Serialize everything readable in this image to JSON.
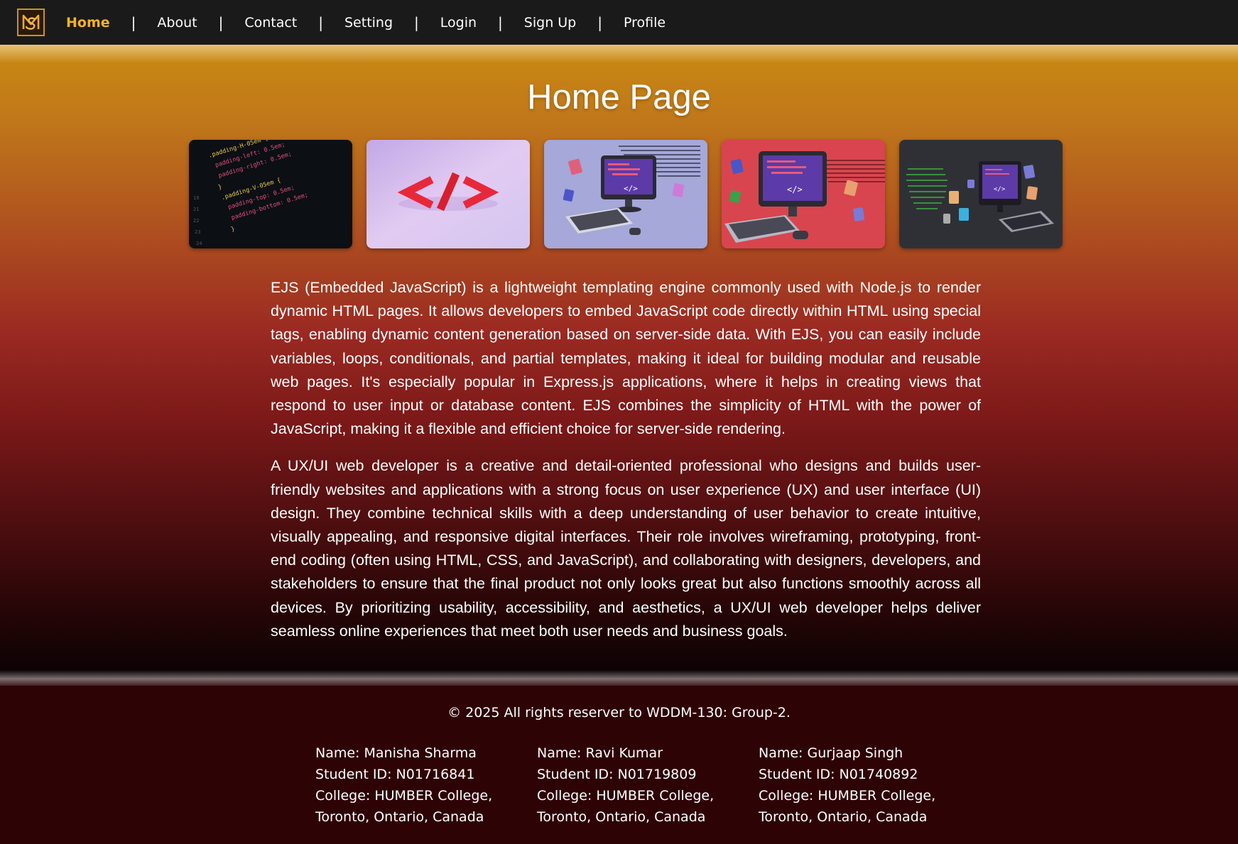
{
  "nav": {
    "logo_icon": "ms-monogram-logo",
    "items": [
      {
        "label": "Home",
        "active": true
      },
      {
        "label": "About",
        "active": false
      },
      {
        "label": "Contact",
        "active": false
      },
      {
        "label": "Setting",
        "active": false
      },
      {
        "label": "Login",
        "active": false
      },
      {
        "label": "Sign Up",
        "active": false
      },
      {
        "label": "Profile",
        "active": false
      }
    ],
    "separator": "|"
  },
  "main": {
    "title": "Home Page",
    "gallery": [
      {
        "icon": "css-code-image"
      },
      {
        "icon": "code-tag-image"
      },
      {
        "icon": "computer-lavender-image"
      },
      {
        "icon": "computer-red-image"
      },
      {
        "icon": "computer-dark-image"
      }
    ],
    "paragraphs": [
      "EJS (Embedded JavaScript) is a lightweight templating engine commonly used with Node.js to render dynamic HTML pages. It allows developers to embed JavaScript code directly within HTML using special tags, enabling dynamic content generation based on server-side data. With EJS, you can easily include variables, loops, conditionals, and partial templates, making it ideal for building modular and reusable web pages. It's especially popular in Express.js applications, where it helps in creating views that respond to user input or database content. EJS combines the simplicity of HTML with the power of JavaScript, making it a flexible and efficient choice for server-side rendering.",
      "A UX/UI web developer is a creative and detail-oriented professional who designs and builds user-friendly websites and applications with a strong focus on user experience (UX) and user interface (UI) design. They combine technical skills with a deep understanding of user behavior to create intuitive, visually appealing, and responsive digital interfaces. Their role involves wireframing, prototyping, front-end coding (often using HTML, CSS, and JavaScript), and collaborating with designers, developers, and stakeholders to ensure that the final product not only looks great but also functions smoothly across all devices. By prioritizing usability, accessibility, and aesthetics, a UX/UI web developer helps deliver seamless online experiences that meet both user needs and business goals."
    ],
    "css_snippet": [
      ".padding-H-05em {",
      "  padding-left: 0.5em;",
      "  padding-right: 0.5em;",
      "}",
      ".padding-V-05em {",
      "  padding-top: 0.5em;",
      "  padding-bottom: 0.5em;",
      "}"
    ]
  },
  "footer": {
    "copyright": "© 2025 All rights reserver to WDDM-130: Group-2.",
    "members": [
      {
        "name": "Name: Manisha Sharma",
        "student_id": "Student ID: N01716841",
        "college": "College: HUMBER College,",
        "location": "Toronto, Ontario, Canada"
      },
      {
        "name": "Name: Ravi Kumar",
        "student_id": "Student ID: N01719809",
        "college": "College: HUMBER College,",
        "location": "Toronto, Ontario, Canada"
      },
      {
        "name": "Name: Gurjaap Singh",
        "student_id": "Student ID: N01740892",
        "college": "College: HUMBER College,",
        "location": "Toronto, Ontario, Canada"
      }
    ]
  },
  "colors": {
    "nav_bg": "#1a1a1a",
    "active_link": "#f7b51c",
    "footer_bg": "#2e0306",
    "gradient_top": "#c98a12",
    "gradient_mid": "#9b2a22",
    "gradient_bottom": "#0a0203"
  }
}
